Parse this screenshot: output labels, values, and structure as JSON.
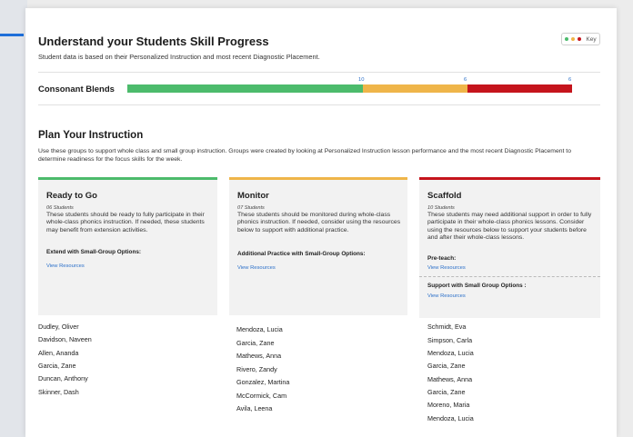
{
  "header": {
    "title": "Understand your Students Skill Progress",
    "subtitle": "Student data is based on their Personalized Instruction and most recent Diagnostic Placement.",
    "key_label": "Key"
  },
  "colors": {
    "green": "#4cbb6c",
    "yellow": "#efb549",
    "red": "#c5141c",
    "link": "#2a6fc9"
  },
  "skill": {
    "name": "Consonant Blends",
    "segments": [
      {
        "status": "ready",
        "count": "10"
      },
      {
        "status": "monitor",
        "count": "6"
      },
      {
        "status": "scaffold",
        "count": "6"
      }
    ]
  },
  "plan": {
    "title": "Plan Your Instruction",
    "description": "Use these groups to support whole class and small group instruction. Groups were created by looking at Personalized Instruction lesson performance and the most recent Diagnostic Placement to determine readiness for the focus skills for the week."
  },
  "groups": [
    {
      "name": "Ready to Go",
      "count": "06 Students",
      "description": "These students should be ready to fully participate in their whole-class phonics instruction. If needed, these students may benefit from extension activities.",
      "option_title": "Extend with Small-Group Options:",
      "option_link": "View Resources",
      "students": [
        "Dudley, Oliver",
        "Davidson, Naveen",
        "Allen, Ananda",
        "Garcia, Zane",
        "Duncan, Anthony",
        "Skinner, Dash"
      ]
    },
    {
      "name": "Monitor",
      "count": "07 Students",
      "description": "These students should be monitored during whole-class phonics instruction. If needed, consider using the resources below to support with additional practice.",
      "option_title": "Additional Practice with Small-Group Options:",
      "option_link": "View Resources",
      "students": [
        "Mendoza, Lucia",
        "Garcia, Zane",
        "Mathews, Anna",
        "Rivero, Zandy",
        "Gonzalez, Martina",
        "McCormick, Cam",
        "Avila, Leena"
      ]
    },
    {
      "name": "Scaffold",
      "count": "10 Students",
      "description": "These students may need additional support in order to fully participate in their whole-class phonics lessons. Consider using the resources below to support your students before and after their whole-class lessons.",
      "preteach_title": "Pre-teach:",
      "preteach_link": "View Resources",
      "option_title": "Support with Small Group Options :",
      "option_link": "View Resources",
      "students": [
        "Schmidt, Eva",
        "Simpson, Carla",
        "Mendoza, Lucia",
        "Garcia, Zane",
        "Mathews, Anna",
        "Garcia, Zane",
        "Moreno, Maria",
        "Mendoza, Lucia"
      ]
    }
  ]
}
